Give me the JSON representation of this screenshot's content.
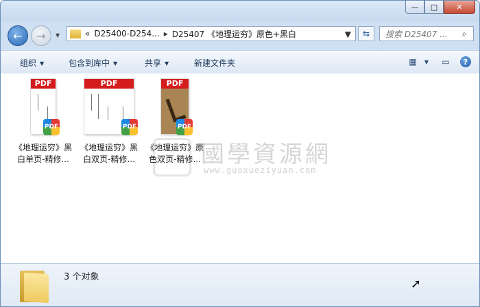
{
  "titlebar": {
    "minimize_glyph": "—",
    "maximize_glyph": "□",
    "close_glyph": "✕"
  },
  "nav": {
    "back_glyph": "←",
    "forward_glyph": "→",
    "dropdown_glyph": "▼"
  },
  "address": {
    "overflow": "«",
    "crumbs": [
      "D25400-D254...",
      "D25407 《地理运穷》原色+黑白"
    ],
    "separator": "▸",
    "dropdown_glyph": "▼",
    "refresh_glyph": "⇆"
  },
  "search": {
    "placeholder": "搜索 D25407 ...",
    "icon": "search-icon",
    "glyph": "⌕"
  },
  "toolbar": {
    "organize": "组织",
    "include_library": "包含到库中",
    "share": "共享",
    "new_folder": "新建文件夹",
    "view_glyph": "▦",
    "view_drop_glyph": "▼",
    "preview_glyph": "▭",
    "help_glyph": "?"
  },
  "files": [
    {
      "line1": "《地理运穷》黑",
      "line2": "白单页-精修...",
      "tag": "PDF",
      "badge": "PDF"
    },
    {
      "line1": "《地理运穷》黑",
      "line2": "白双页-精修...",
      "tag": "PDF",
      "badge": "PDF"
    },
    {
      "line1": "《地理运穷》原",
      "line2": "色双页-精修...",
      "tag": "PDF",
      "badge": "PDF"
    }
  ],
  "watermark": {
    "main": "國學資源網",
    "sub": "www.guoxueziyuan.com"
  },
  "status": {
    "count_text": "3 个对象"
  },
  "colors": {
    "pdf_red": "#d51c1c",
    "accent_blue": "#2a68b8"
  }
}
